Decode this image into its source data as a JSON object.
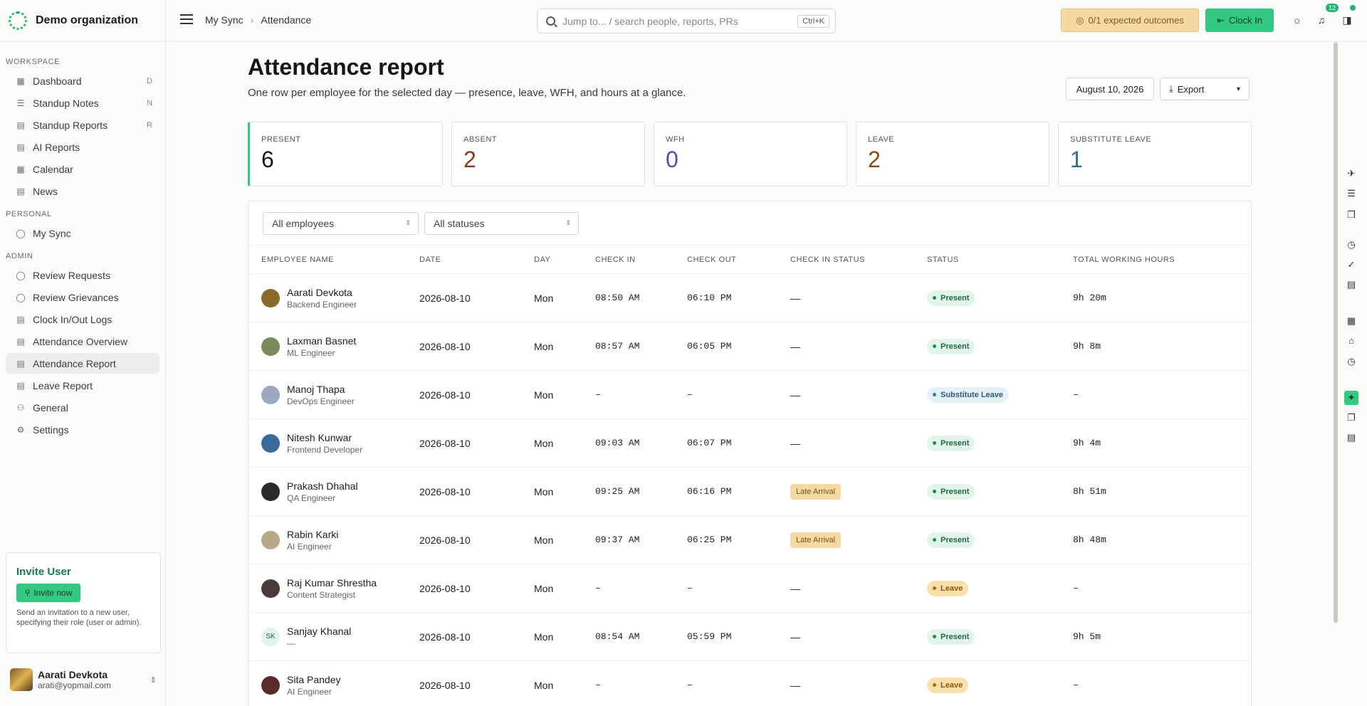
{
  "brand": {
    "name": "Demo organization"
  },
  "sidebar": {
    "sections": [
      {
        "title": "WORKSPACE",
        "items": [
          {
            "label": "Dashboard",
            "icon": "grid-icon",
            "glyph": "▦",
            "kbd": "D"
          },
          {
            "label": "Standup Notes",
            "icon": "list-icon",
            "glyph": "☰",
            "kbd": "N"
          },
          {
            "label": "Standup Reports",
            "icon": "clipboard-icon",
            "glyph": "▤",
            "kbd": "R"
          },
          {
            "label": "AI Reports",
            "icon": "file-icon",
            "glyph": "▤",
            "kbd": ""
          },
          {
            "label": "Calendar",
            "icon": "calendar-icon",
            "glyph": "▦",
            "kbd": ""
          },
          {
            "label": "News",
            "icon": "news-icon",
            "glyph": "▤",
            "kbd": ""
          }
        ]
      },
      {
        "title": "PERSONAL",
        "items": [
          {
            "label": "My Sync",
            "icon": "user-icon",
            "glyph": "◯",
            "kbd": ""
          }
        ]
      },
      {
        "title": "ADMIN",
        "items": [
          {
            "label": "Review Requests",
            "icon": "user-search-icon",
            "glyph": "◯",
            "kbd": ""
          },
          {
            "label": "Review Grievances",
            "icon": "user-alert-icon",
            "glyph": "◯",
            "kbd": ""
          },
          {
            "label": "Clock In/Out Logs",
            "icon": "log-icon",
            "glyph": "▤",
            "kbd": ""
          },
          {
            "label": "Attendance Overview",
            "icon": "clipboard-icon",
            "glyph": "▤",
            "kbd": ""
          },
          {
            "label": "Attendance Report",
            "icon": "report-icon",
            "glyph": "▤",
            "kbd": "",
            "active": true
          },
          {
            "label": "Leave Report",
            "icon": "clipboard-icon",
            "glyph": "▤",
            "kbd": ""
          },
          {
            "label": "General",
            "icon": "users-icon",
            "glyph": "⚇",
            "kbd": ""
          },
          {
            "label": "Settings",
            "icon": "gear-icon",
            "glyph": "⚙",
            "kbd": ""
          }
        ]
      }
    ],
    "invite": {
      "title": "Invite User",
      "button": "Invite now",
      "text": "Send an invitation to a new user, specifying their role (user or admin)."
    },
    "user": {
      "name": "Aarati Devkota",
      "email": "arati@yopmail.com"
    }
  },
  "topbar": {
    "breadcrumb": [
      "My Sync",
      "Attendance"
    ],
    "search_placeholder": "Jump to... / search people, reports, PRs",
    "search_kbd": "Ctrl+K",
    "outcomes": "0/1 expected outcomes",
    "clockin": "Clock In",
    "notifications": "12"
  },
  "page": {
    "title": "Attendance report",
    "subtitle": "One row per employee for the selected day — presence, leave, WFH, and hours at a glance.",
    "date": "August 10, 2026",
    "export": "Export"
  },
  "stats": [
    {
      "label": "PRESENT",
      "value": "6",
      "color": "#1a1a1a"
    },
    {
      "label": "ABSENT",
      "value": "2",
      "color": "#8a3a1a"
    },
    {
      "label": "WFH",
      "value": "0",
      "color": "#6a3fc9"
    },
    {
      "label": "LEAVE",
      "value": "2",
      "color": "#8a4a12"
    },
    {
      "label": "SUBSTITUTE LEAVE",
      "value": "1",
      "color": "#2a6f95"
    }
  ],
  "filters": {
    "employees": "All employees",
    "statuses": "All statuses"
  },
  "table": {
    "headers": [
      "EMPLOYEE NAME",
      "DATE",
      "DAY",
      "CHECK IN",
      "CHECK OUT",
      "CHECK IN STATUS",
      "STATUS",
      "TOTAL WORKING HOURS"
    ],
    "rows": [
      {
        "name": "Aarati Devkota",
        "role": "Backend Engineer",
        "date": "2026-08-10",
        "day": "Mon",
        "in": "08:50 AM",
        "out": "06:10 PM",
        "in_status": "—",
        "late": false,
        "status": "Present",
        "kind": "present",
        "hours": "9h 20m",
        "initials": "",
        "avatar": "#8a6a2a"
      },
      {
        "name": "Laxman Basnet",
        "role": "ML Engineer",
        "date": "2026-08-10",
        "day": "Mon",
        "in": "08:57 AM",
        "out": "06:05 PM",
        "in_status": "—",
        "late": false,
        "status": "Present",
        "kind": "present",
        "hours": "9h 8m",
        "initials": "",
        "avatar": "#7b8a5a"
      },
      {
        "name": "Manoj Thapa",
        "role": "DevOps Engineer",
        "date": "2026-08-10",
        "day": "Mon",
        "in": "–",
        "out": "–",
        "in_status": "—",
        "late": false,
        "status": "Substitute Leave",
        "kind": "sub",
        "hours": "–",
        "initials": "",
        "avatar": "#9aa8c0"
      },
      {
        "name": "Nitesh Kunwar",
        "role": "Frontend Developer",
        "date": "2026-08-10",
        "day": "Mon",
        "in": "09:03 AM",
        "out": "06:07 PM",
        "in_status": "—",
        "late": false,
        "status": "Present",
        "kind": "present",
        "hours": "9h 4m",
        "initials": "",
        "avatar": "#3a6a9a"
      },
      {
        "name": "Prakash Dhahal",
        "role": "QA Engineer",
        "date": "2026-08-10",
        "day": "Mon",
        "in": "09:25 AM",
        "out": "06:16 PM",
        "in_status": "Late Arrival",
        "late": true,
        "status": "Present",
        "kind": "present",
        "hours": "8h 51m",
        "initials": "",
        "avatar": "#2a2a2a"
      },
      {
        "name": "Rabin Karki",
        "role": "AI Engineer",
        "date": "2026-08-10",
        "day": "Mon",
        "in": "09:37 AM",
        "out": "06:25 PM",
        "in_status": "Late Arrival",
        "late": true,
        "status": "Present",
        "kind": "present",
        "hours": "8h 48m",
        "initials": "",
        "avatar": "#b8a88a"
      },
      {
        "name": "Raj Kumar Shrestha",
        "role": "Content Strategist",
        "date": "2026-08-10",
        "day": "Mon",
        "in": "–",
        "out": "–",
        "in_status": "—",
        "late": false,
        "status": "Leave",
        "kind": "leave",
        "hours": "–",
        "initials": "",
        "avatar": "#4a3a3a"
      },
      {
        "name": "Sanjay Khanal",
        "role": "—",
        "date": "2026-08-10",
        "day": "Mon",
        "in": "08:54 AM",
        "out": "05:59 PM",
        "in_status": "—",
        "late": false,
        "status": "Present",
        "kind": "present",
        "hours": "9h 5m",
        "initials": "SK",
        "avatar": "#e3f5ea"
      },
      {
        "name": "Sita Pandey",
        "role": "AI Engineer",
        "date": "2026-08-10",
        "day": "Mon",
        "in": "–",
        "out": "–",
        "in_status": "—",
        "late": false,
        "status": "Leave",
        "kind": "leave",
        "hours": "–",
        "initials": "",
        "avatar": "#5a2a2a"
      }
    ]
  },
  "rail": [
    {
      "icon": "plane-icon",
      "glyph": "✈",
      "on": false
    },
    {
      "icon": "list-icon",
      "glyph": "☰",
      "on": false
    },
    {
      "icon": "copy-icon",
      "glyph": "❐",
      "on": false
    },
    {
      "icon": "timer-icon",
      "glyph": "◷",
      "on": false
    },
    {
      "icon": "check-icon",
      "glyph": "✓",
      "on": false
    },
    {
      "icon": "note-icon",
      "glyph": "▤",
      "on": false
    },
    {
      "icon": "calendar-x-icon",
      "glyph": "▦",
      "on": false
    },
    {
      "icon": "home-icon",
      "glyph": "⌂",
      "on": false
    },
    {
      "icon": "clock-icon",
      "glyph": "◷",
      "on": false
    },
    {
      "icon": "sparkle-icon",
      "glyph": "✦",
      "on": true
    },
    {
      "icon": "copy-icon",
      "glyph": "❐",
      "on": false
    },
    {
      "icon": "ai-file-icon",
      "glyph": "▤",
      "on": false
    }
  ]
}
